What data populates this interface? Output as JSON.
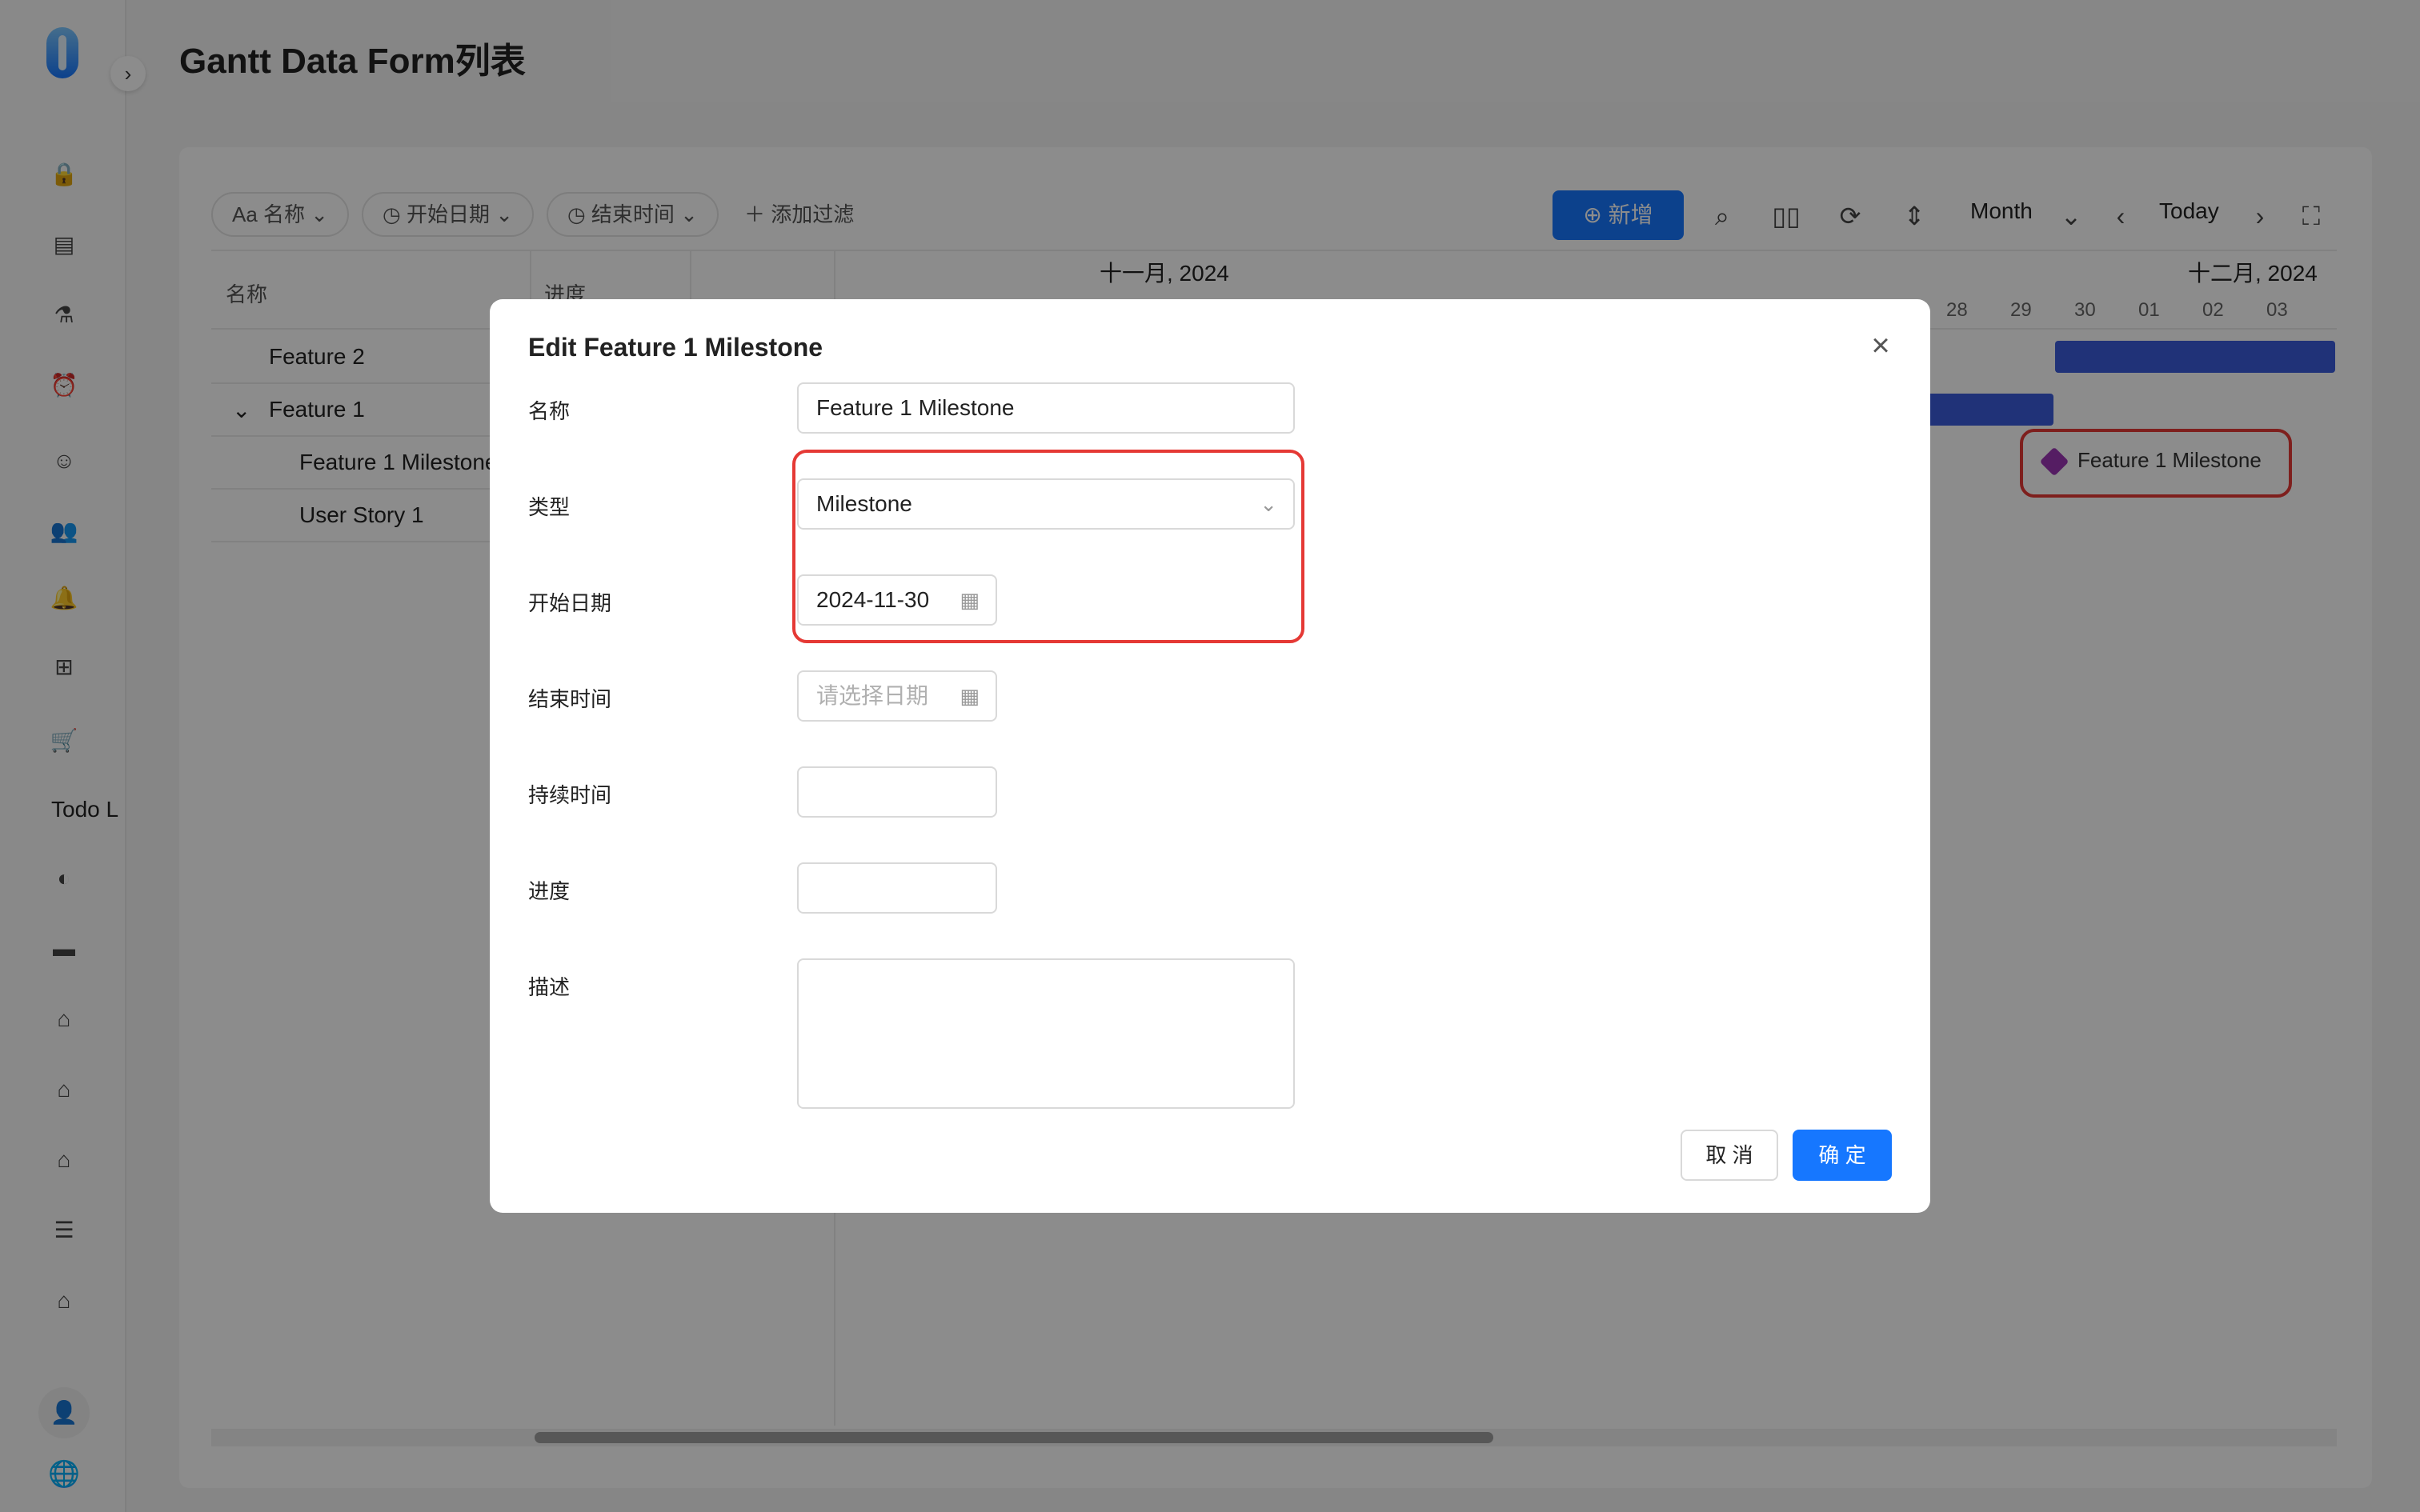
{
  "page": {
    "title": "Gantt Data Form列表"
  },
  "sidebar": {
    "todo_label": "Todo L",
    "icons": [
      "lock-icon",
      "calendar-icon",
      "flask-icon",
      "alarm-icon",
      "smiley-icon",
      "people-icon",
      "bell-icon",
      "network-icon",
      "cart-icon",
      "globe-icon",
      "folder-icon",
      "home-icon",
      "home-icon",
      "home-icon",
      "menu-icon",
      "home-icon"
    ]
  },
  "toolbar": {
    "filter_name": "Aa 名称",
    "filter_start": "开始日期",
    "filter_end": "结束时间",
    "add_filter": "添加过滤",
    "add_button": "新增",
    "view_select": "Month",
    "today": "Today"
  },
  "table": {
    "col_name": "名称",
    "col_progress": "进度",
    "rows": [
      "Feature 2",
      "Feature 1",
      "Feature 1 Milestone",
      "User Story 1"
    ]
  },
  "gantt": {
    "month_nov": "十一月, 2024",
    "month_dec": "十二月, 2024",
    "days": [
      "28",
      "29",
      "30",
      "01",
      "02",
      "03"
    ],
    "milestone_label": "Feature 1 Milestone",
    "colors": {
      "bar": "#3b5bdb",
      "milestone": "#9c36b5"
    }
  },
  "modal": {
    "title": "Edit Feature 1 Milestone",
    "labels": {
      "name": "名称",
      "type": "类型",
      "start": "开始日期",
      "end": "结束时间",
      "duration": "持续时间",
      "progress": "进度",
      "description": "描述"
    },
    "values": {
      "name": "Feature 1 Milestone",
      "type": "Milestone",
      "start": "2024-11-30",
      "end_placeholder": "请选择日期"
    },
    "cancel": "取 消",
    "ok": "确 定"
  },
  "colors": {
    "accent": "#1677ff",
    "highlight": "#e53935"
  }
}
